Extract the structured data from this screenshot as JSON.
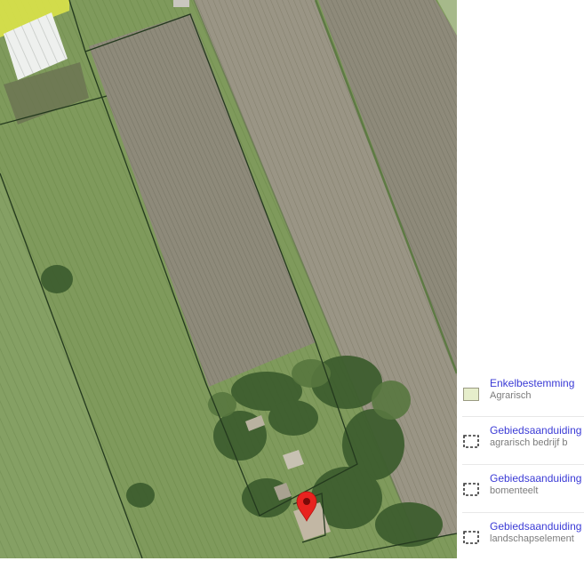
{
  "map": {
    "base_layer": "aerial-photo",
    "marker_icon": "map-pin-icon",
    "marker_color": "#e8231f",
    "parcel_outline_color": "#243a1e",
    "highlight_color": "#d9e24a"
  },
  "legend": {
    "items": [
      {
        "title": "Enkelbestemming",
        "subtitle": "Agrarisch",
        "swatch": "fill",
        "swatch_color": "#e6eecb"
      },
      {
        "title": "Gebiedsaanduiding",
        "subtitle": "agrarisch bedrijf b",
        "swatch": "dashed-square-icon"
      },
      {
        "title": "Gebiedsaanduiding",
        "subtitle": "bomenteelt",
        "swatch": "dashed-square-icon"
      },
      {
        "title": "Gebiedsaanduiding",
        "subtitle": "landschapselement",
        "swatch": "dashed-square-icon"
      }
    ]
  }
}
